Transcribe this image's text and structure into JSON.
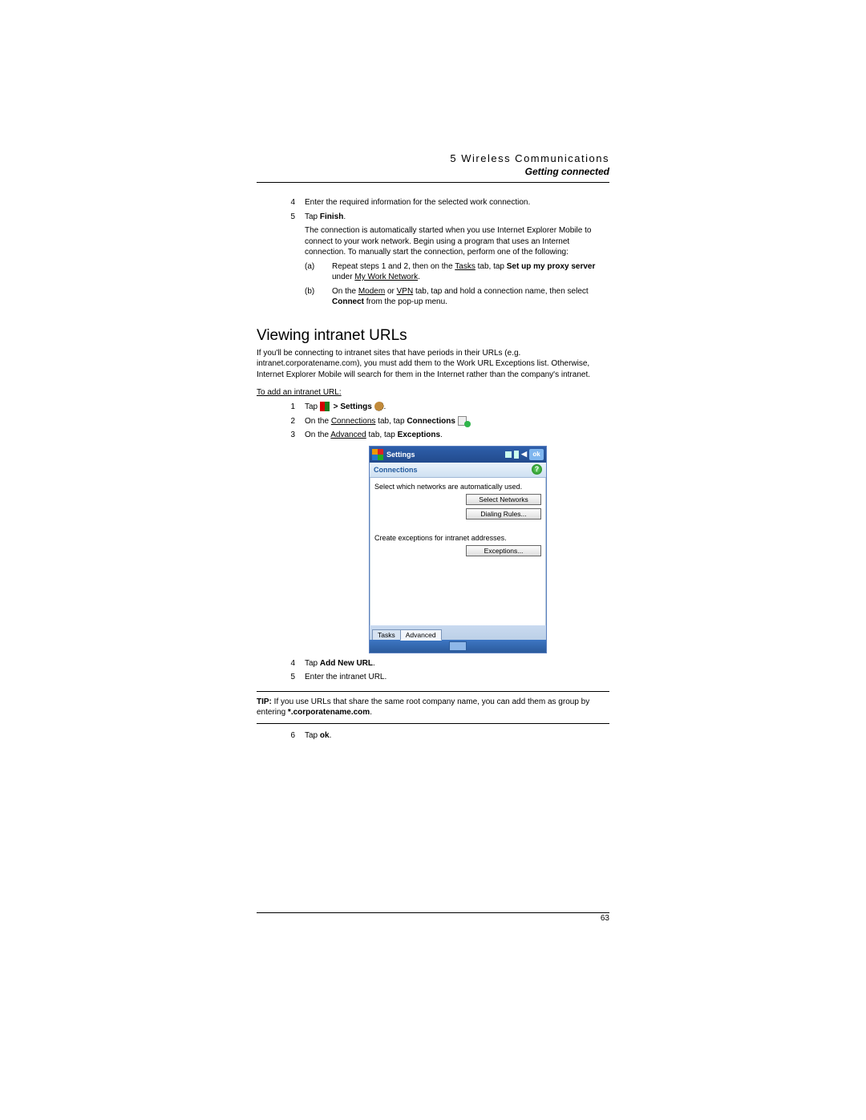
{
  "header": {
    "chapter": "5 Wireless Communications",
    "section": "Getting connected"
  },
  "top_list": {
    "item4_num": "4",
    "item4_text": "Enter the required information for the selected work connection.",
    "item5_num": "5",
    "item5_pre": "Tap ",
    "item5_bold": "Finish",
    "item5_post": ".",
    "para": "The connection is automatically started when you use Internet Explorer Mobile to connect to your work network. Begin using a program that uses an Internet connection. To manually start the connection, perform one of the following:",
    "a_lbl": "(a)",
    "a_pre": "Repeat steps 1 and 2, then on the ",
    "a_u1": "Tasks",
    "a_mid": " tab, tap ",
    "a_b": "Set up my proxy server",
    "a_post1": " under ",
    "a_u2": "My Work Network",
    "a_post2": ".",
    "b_lbl": "(b)",
    "b_pre": "On the ",
    "b_u1": "Modem",
    "b_mid1": " or ",
    "b_u2": "VPN",
    "b_mid2": " tab, tap and hold a connection name, then select ",
    "b_b": "Connect",
    "b_post": " from the pop-up menu."
  },
  "h2": "Viewing intranet URLs",
  "intro": "If you'll be connecting to intranet sites that have periods in their URLs (e.g. intranet.corporatename.com), you must add them to the Work URL Exceptions list. Otherwise, Internet Explorer Mobile will search for them in the Internet rather than the company's intranet.",
  "subhead": "To add an intranet URL:",
  "steps": {
    "n1": "1",
    "s1_pre": "Tap ",
    "s1_mid": " > ",
    "s1_b": "Settings",
    "s1_post": " ",
    "s1_end": ".",
    "n2": "2",
    "s2_pre": "On the ",
    "s2_u": "Connections",
    "s2_mid": " tab, tap ",
    "s2_b": "Connections",
    "s2_post": " ",
    "s2_end": ".",
    "n3": "3",
    "s3_pre": "On the ",
    "s3_u": "Advanced",
    "s3_mid": " tab, tap ",
    "s3_b": "Exceptions",
    "s3_end": ".",
    "n4": "4",
    "s4_pre": "Tap ",
    "s4_b": "Add New URL",
    "s4_end": ".",
    "n5": "5",
    "s5": "Enter the intranet URL.",
    "n6": "6",
    "s6_pre": "Tap ",
    "s6_b": "ok",
    "s6_end": "."
  },
  "screenshot": {
    "title": "Settings",
    "ok": "ok",
    "subtitle": "Connections",
    "line1": "Select which networks are automatically used.",
    "btn1": "Select Networks",
    "btn2": "Dialing Rules...",
    "line2": "Create exceptions for intranet addresses.",
    "btn3": "Exceptions...",
    "tab1": "Tasks",
    "tab2": "Advanced"
  },
  "tip": {
    "label": "TIP:",
    "text_pre": "   If you use URLs that share the same root company name, you can add them as group by entering ",
    "bold": "*.corporatename.com",
    "post": "."
  },
  "page_number": "63"
}
